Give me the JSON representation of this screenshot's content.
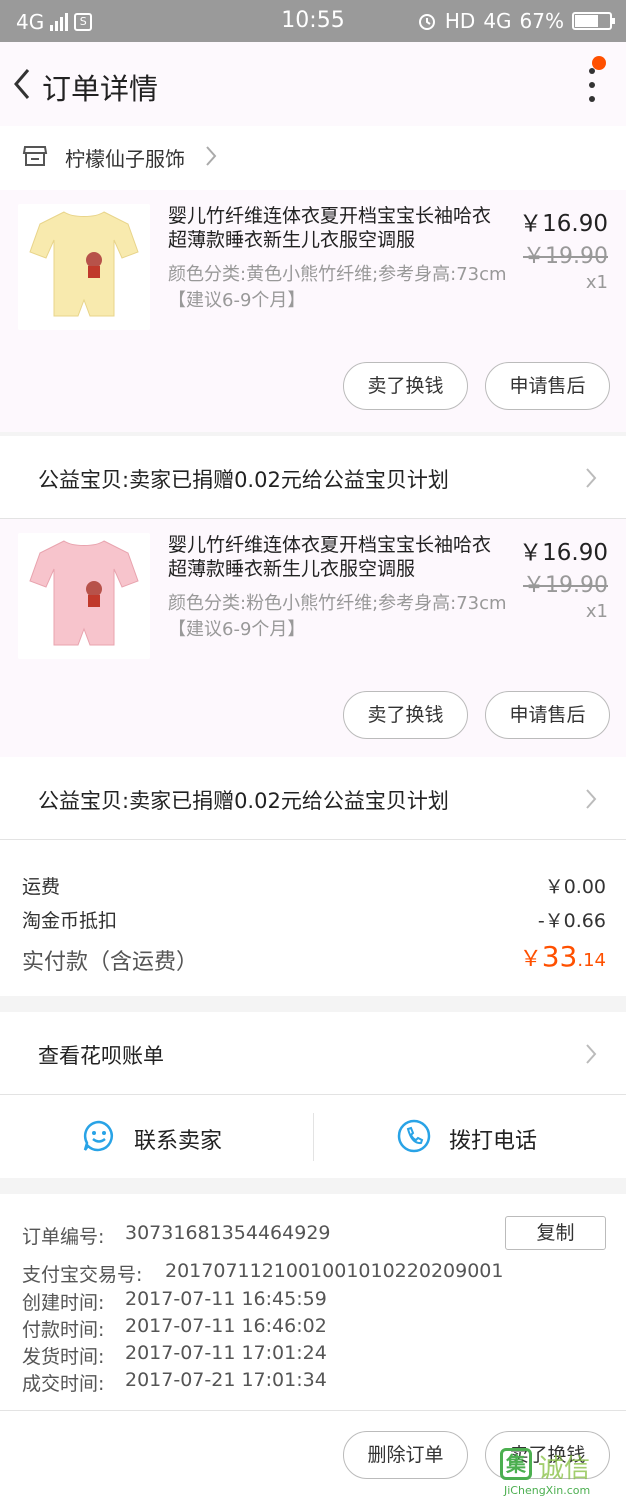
{
  "status_bar": {
    "network": "4G",
    "time": "10:55",
    "hd": "HD",
    "network2": "4G",
    "battery": "67%",
    "battery_level": 0.67
  },
  "header": {
    "title": "订单详情"
  },
  "shop": {
    "name": "柠檬仙子服饰"
  },
  "items": [
    {
      "title": "婴儿竹纤维连体衣夏开档宝宝长袖哈衣超薄款睡衣新生儿衣服空调服",
      "spec": "颜色分类:黄色小熊竹纤维;参考身高:73cm【建议6-9个月】",
      "price": "￥16.90",
      "original_price": "￥19.90",
      "quantity": "x1",
      "color": "#f8eaae",
      "btn_sell": "卖了换钱",
      "btn_aftersale": "申请售后"
    },
    {
      "title": "婴儿竹纤维连体衣夏开档宝宝长袖哈衣超薄款睡衣新生儿衣服空调服",
      "spec": "颜色分类:粉色小熊竹纤维;参考身高:73cm【建议6-9个月】",
      "price": "￥16.90",
      "original_price": "￥19.90",
      "quantity": "x1",
      "color": "#f7c4cc",
      "btn_sell": "卖了换钱",
      "btn_aftersale": "申请售后"
    }
  ],
  "charity": {
    "text": "公益宝贝:卖家已捐赠0.02元给公益宝贝计划"
  },
  "costs": {
    "shipping_label": "运费",
    "shipping_value": "￥0.00",
    "coin_label": "淘金币抵扣",
    "coin_value": "-￥0.66",
    "total_label": "实付款（含运费）",
    "total_currency": "￥",
    "total_int": "33",
    "total_dec": ".14"
  },
  "huabei": {
    "text": "查看花呗账单"
  },
  "contact": {
    "seller": "联系卖家",
    "call": "拨打电话"
  },
  "order_info": {
    "order_no_label": "订单编号:",
    "order_no": "307316813544649​29",
    "copy": "复制",
    "alipay_label": "支付宝交易号:",
    "alipay_no": "2017071121001001010220209001",
    "created_label": "创建时间:",
    "created": "2017-07-11 16:45:59",
    "paid_label": "付款时间:",
    "paid": "2017-07-11 16:46:02",
    "shipped_label": "发货时间:",
    "shipped": "2017-07-11 17:01:24",
    "done_label": "成交时间:",
    "done": "2017-07-21 17:01:34"
  },
  "bottom": {
    "delete": "删除订单",
    "sell": "卖了换钱"
  },
  "watermark": {
    "logo": "集",
    "cn": "诚信",
    "en": "JiChengXin.com"
  },
  "colors": {
    "accent": "#ff5000",
    "ui_blue": "#29a3e6"
  }
}
